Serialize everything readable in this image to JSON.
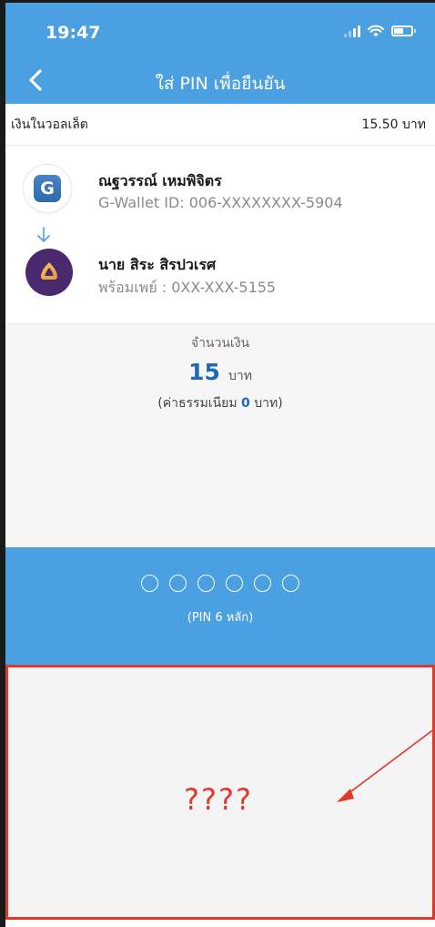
{
  "status_bar": {
    "time": "19:47",
    "icons": [
      "signal-icon",
      "wifi-icon",
      "battery-icon"
    ]
  },
  "nav": {
    "title": "ใส่ PIN เพื่อยืนยัน",
    "back_icon": "chevron-left-icon"
  },
  "wallet": {
    "label": "เงินในวอลเล็ต",
    "balance": "15.50 บาท"
  },
  "transfer": {
    "sender": {
      "name": "ณฐวรรณ์ เหมพิจิตร",
      "id": "G-Wallet ID: 006-XXXXXXXX-5904",
      "logo_icon": "g-wallet-logo-icon",
      "logo_letter": "G"
    },
    "arrow_icon": "arrow-down-icon",
    "receiver": {
      "name": "นาย สิระ สิรปวเรศ",
      "id": "พร้อมเพย์ : 0XX-XXX-5155",
      "logo_icon": "promptpay-logo-icon"
    }
  },
  "amount": {
    "label": "จำนวนเงิน",
    "value": "15",
    "unit": "บาท",
    "fee_prefix": "(ค่าธรรมเนียม",
    "fee_value": "0",
    "fee_suffix": "บาท)"
  },
  "pin": {
    "length": 6,
    "filled": 0,
    "hint": "(PIN 6 หลัก)"
  },
  "keypad": {
    "placeholder": "????"
  },
  "colors": {
    "primary_blue": "#4aa0e0",
    "amount_blue": "#2168b5",
    "annotation_red": "#e0392b"
  }
}
